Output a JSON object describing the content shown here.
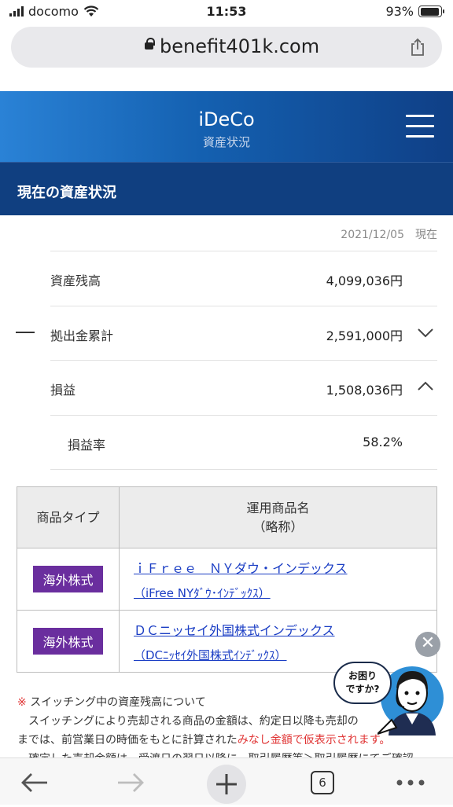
{
  "status": {
    "carrier": "docomo",
    "time": "11:53",
    "battery": "93%",
    "battery_level": 0.93
  },
  "browser": {
    "url": "benefit401k.com",
    "tab_count": "6"
  },
  "header": {
    "title": "iDeCo",
    "subtitle": "資産状況"
  },
  "section": {
    "title": "現在の資産状況"
  },
  "asof": {
    "date": "2021/12/05",
    "label": "現在"
  },
  "summary": {
    "balance_label": "資産残高",
    "balance_value": "4,099,036円",
    "contrib_label": "拠出金累計",
    "contrib_value": "2,591,000円",
    "pl_label": "損益",
    "pl_value": "1,508,036円",
    "rate_label": "損益率",
    "rate_value": "58.2%"
  },
  "table": {
    "col1": "商品タイプ",
    "col2_line1": "運用商品名",
    "col2_line2": "（略称）",
    "rows": [
      {
        "type": "海外株式",
        "name": "ｉＦｒｅｅ　ＮＹダウ・インデックス",
        "short": "（iFree NYﾀﾞｳ･ｲﾝﾃﾞｯｸｽ）"
      },
      {
        "type": "海外株式",
        "name": "ＤＣニッセイ外国株式インデックス",
        "short": "（DCﾆｯｾｲ外国株式ｲﾝﾃﾞｯｸｽ）"
      }
    ]
  },
  "note": {
    "asterisk": "※",
    "heading": "スイッチング中の資産残高について",
    "line1": "　スイッチングにより売却される商品の金額は、約定日以降も売却の",
    "line2_a": "までは、前営業日の時価をもとに計算された",
    "line2_red": "みなし金額で仮表示されます。",
    "line3": "　確定した売却金額は、受渡日の翌日以降に、取引履歴等＞取引履歴にてご確認"
  },
  "helper": {
    "bubble_line1": "お困り",
    "bubble_line2": "ですか?",
    "close": "✕"
  }
}
